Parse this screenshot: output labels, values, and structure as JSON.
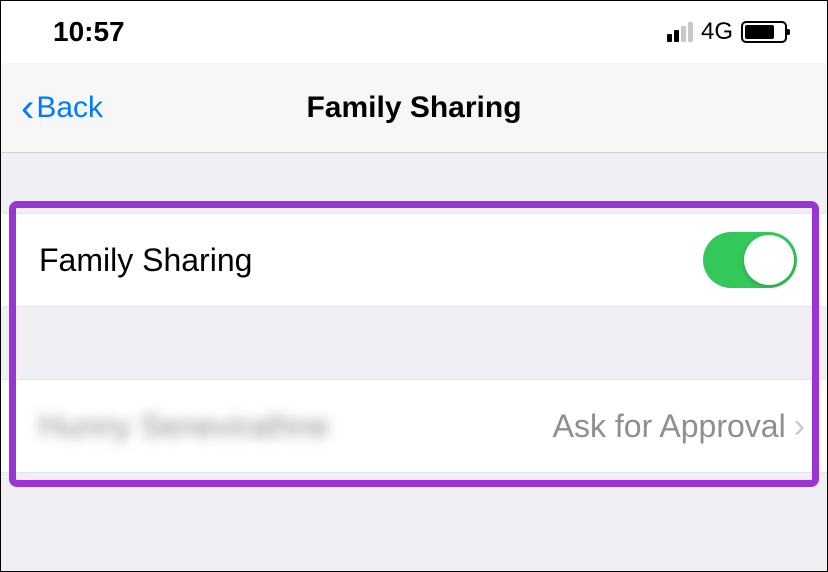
{
  "statusBar": {
    "time": "10:57",
    "networkLabel": "4G"
  },
  "navHeader": {
    "backLabel": "Back",
    "title": "Family Sharing"
  },
  "settings": {
    "toggleRow": {
      "label": "Family Sharing",
      "enabled": true
    },
    "memberRow": {
      "name": "Hunny Senevirathne",
      "value": "Ask for Approval"
    }
  },
  "colors": {
    "accent": "#007aff",
    "toggleOn": "#34c759",
    "highlight": "#9a34d4"
  }
}
